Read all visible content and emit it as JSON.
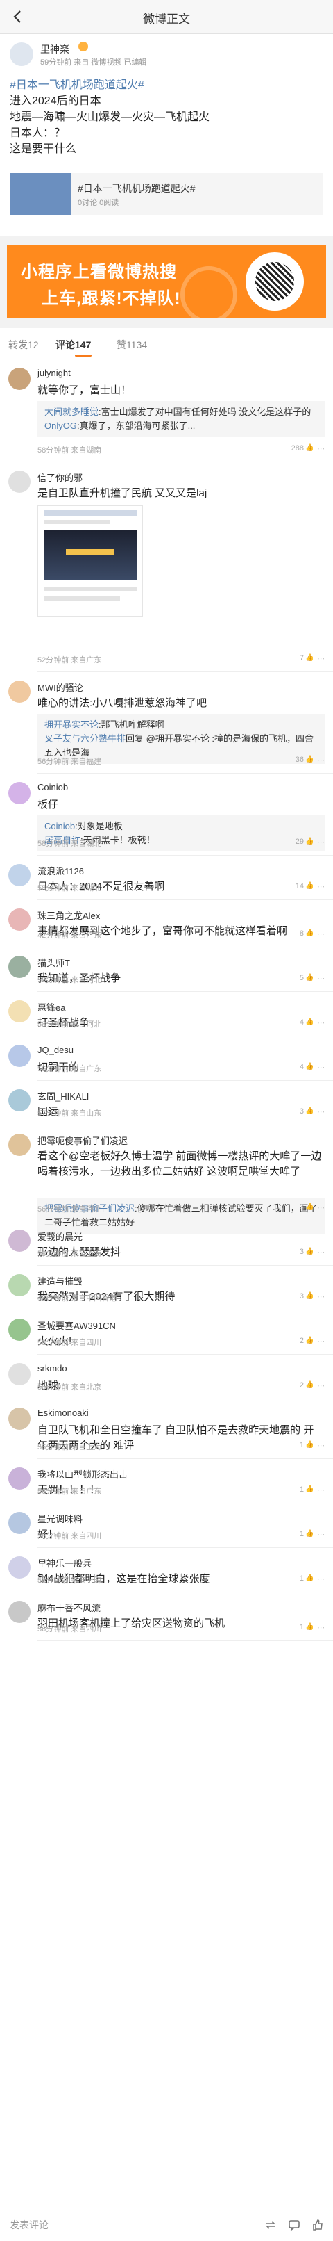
{
  "header": {
    "title": "微博正文"
  },
  "post": {
    "author": "里神楽",
    "meta": "59分钟前 来自 微博视频 已编辑",
    "lines": [
      "进入2024后的日本",
      "地震—海啸—火山爆发—火灾—飞机起火",
      "日本人：？",
      "这是要干什么"
    ],
    "tag": "#日本一飞机机场跑道起火#",
    "card": {
      "title": "#日本一飞机机场跑道起火#",
      "sub": "0讨论 0阅读"
    }
  },
  "banner": {
    "line1": "小程序上看微博热搜",
    "line2": "上车,跟紧!不掉队!"
  },
  "tabs": {
    "repost": "转发12",
    "comment": "评论147",
    "like": "赞1134"
  },
  "comments": [
    {
      "name": "julynight",
      "text": "就等你了，富士山！",
      "meta": "58分钟前 来自湖南",
      "likes": "288",
      "replies": [
        {
          "name": "大闹就多睡觉",
          "text": ":富士山爆发了对中国有任何好处吗 没文化是这样子的"
        },
        {
          "name": "OnlyOG",
          "text": ":真爆了，东部沿海可紧张了..."
        }
      ]
    },
    {
      "name": "信了你的邪",
      "text": "是自卫队直升机撞了民航 又又又是laj",
      "meta": "52分钟前 来自广东",
      "likes": "7"
    },
    {
      "name": "MWI的骚论",
      "text": "唯心的讲法:小八嘎排泄惹怒海神了吧",
      "meta": "56分钟前 来自福建",
      "likes": "36",
      "replies": [
        {
          "name": "拥开暴实不论",
          "text": ":那飞机咋解释啊"
        },
        {
          "name": "叉子友与六分熟牛排",
          "text": "回复 @拥开暴实不论 :撞的是海保的飞机，四舍五入也是海"
        }
      ]
    },
    {
      "name": "Coiniob",
      "text": "板仔",
      "meta": "58分钟前 来自湖北",
      "likes": "29",
      "replies": [
        {
          "name": "Coiniob",
          "text": ":对象是地板"
        },
        {
          "name": "居高自许",
          "text": ":天闹黑卡！板戟！"
        }
      ]
    },
    {
      "name": "流浪派1126",
      "text": "日本人：2024不是很友善啊",
      "meta": "58分钟前 来自湖北",
      "likes": "14"
    },
    {
      "name": "珠三角之龙Alex",
      "text": "事情都发展到这个地步了，富哥你可不能就这样看着啊",
      "meta": "42分钟前 来自广东",
      "likes": "8"
    },
    {
      "name": "猫头师T",
      "text": "我知道，圣杯战争",
      "meta": "58分钟前 来自河北",
      "likes": "5"
    },
    {
      "name": "惠锋ea",
      "text": "打圣杯战争",
      "meta": "58分钟前 来自河北",
      "likes": "4"
    },
    {
      "name": "JQ_desu",
      "text": "切嗣干的",
      "meta": "56分钟前 来自广东",
      "likes": "4"
    },
    {
      "name": "玄間_HIKALI",
      "text": "国运",
      "meta": "57分钟前 来自山东",
      "likes": "3"
    },
    {
      "name": "把霉呃傻事偷子们凌迟",
      "text": "看这个@空老板好久博士温学 前面微博一楼热评的大哞了一边喝着核污水，一边救出多位二姑姑好 这波啊是哄堂大哞了",
      "meta": "56分钟前 来自河北",
      "likes": "3",
      "replies": [
        {
          "name": "把霉呃傻事偷子们凌迟",
          "text": ":傻哪在忙着做三相弹核试验要灭了我们，画了二哥子忙着救二姑姑好"
        }
      ]
    },
    {
      "name": "爱莪的晨光",
      "text": "那边的人瑟瑟发抖",
      "meta": "58分钟前 来自上海",
      "likes": "3"
    },
    {
      "name": "建造与摧毁",
      "text": "我突然对于2024有了很大期待",
      "meta": "48分钟前 来自中国香港",
      "likes": "3"
    },
    {
      "name": "圣城要塞AW391CN",
      "text": "火火火!",
      "meta": "58分钟前 来自四川",
      "likes": "2"
    },
    {
      "name": "srkmdo",
      "text": "地球:",
      "meta": "56分钟前 来自北京",
      "likes": "2"
    },
    {
      "name": "Eskimonoaki",
      "text": "自卫队飞机和全日空撞车了 自卫队怕不是去救昨天地震的 开年两天两个大的 难评",
      "meta": "56分钟前 来自上海",
      "likes": "1"
    },
    {
      "name": "我将以山型锁形态出击",
      "text": "天罚！！！！",
      "meta": "56分钟前 来自广东",
      "likes": "1"
    },
    {
      "name": "星光调味料",
      "text": "好！",
      "meta": "58分钟前 来自四川",
      "likes": "1"
    },
    {
      "name": "里神乐一般兵",
      "text": "钢4战犯都明白，这是在抬全球紧张度",
      "meta": "58分钟前 来自上海",
      "likes": "1"
    },
    {
      "name": "麻布十番不风流",
      "text": "羽田机场客机撞上了给灾区送物资的飞机",
      "meta": "56分钟前 来自四川",
      "likes": "1"
    }
  ],
  "bottom": {
    "placeholder": "发表评论"
  },
  "colors": {
    "accent": "#f77b1b",
    "link": "#507daf",
    "banner": "#ff8a1d"
  }
}
